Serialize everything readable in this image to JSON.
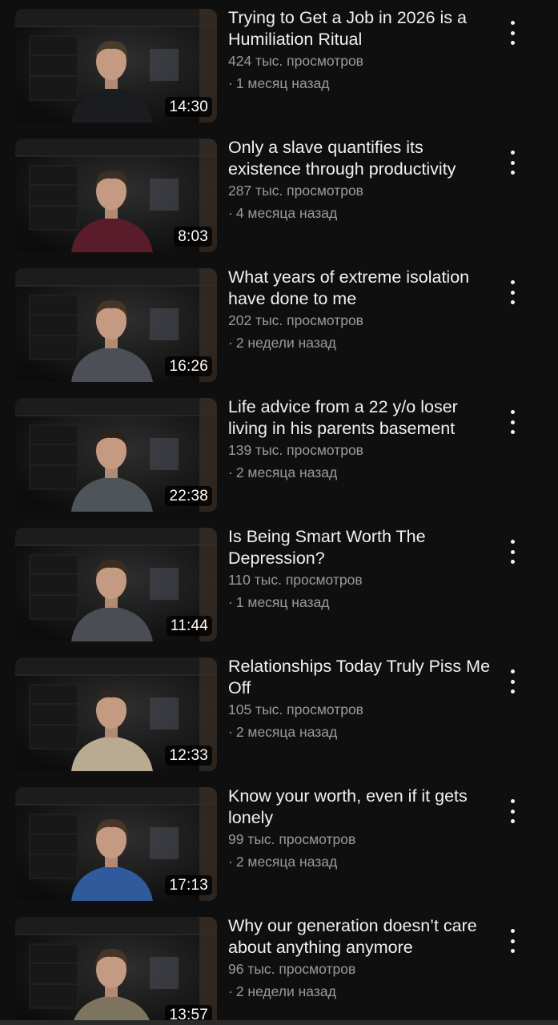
{
  "videos": [
    {
      "title": "Trying to Get a Job in 2026 is a Humiliation Ritual",
      "views": "424 тыс. просмотров",
      "age": "1 месяц назад",
      "duration": "14:30",
      "sweater": "#1b1c20",
      "hair": "#4a3a2c"
    },
    {
      "title": "Only a slave quantifies its existence through productivity",
      "views": "287 тыс. просмотров",
      "age": "4 месяца назад",
      "duration": "8:03",
      "sweater": "#5a1c2a",
      "hair": "#3e2f24"
    },
    {
      "title": "What years of extreme isolation have done to me",
      "views": "202 тыс. просмотров",
      "age": "2 недели назад",
      "duration": "16:26",
      "sweater": "#4c4f55",
      "hair": "#463526"
    },
    {
      "title": "Life advice from a 22 y/o loser living in his parents basement",
      "views": "139 тыс. просмотров",
      "age": "2 месяца назад",
      "duration": "22:38",
      "sweater": "#4f535a",
      "hair": "#2c231c"
    },
    {
      "title": "Is Being Smart Worth The Depression?",
      "views": "110 тыс. просмотров",
      "age": "1 месяц назад",
      "duration": "11:44",
      "sweater": "#4a4e54",
      "hair": "#3b2c20"
    },
    {
      "title": "Relationships Today Truly Piss Me Off",
      "views": "105 тыс. просмотров",
      "age": "2 месяца назад",
      "duration": "12:33",
      "sweater": "#b8ab92",
      "hair": "#2f261f"
    },
    {
      "title": "Know your worth, even if it gets lonely",
      "views": "99 тыс. просмотров",
      "age": "2 месяца назад",
      "duration": "17:13",
      "sweater": "#2f5a9c",
      "hair": "#4a3626"
    },
    {
      "title": "Why our generation doesn’t care about anything anymore",
      "views": "96 тыс. просмотров",
      "age": "2 недели назад",
      "duration": "13:57",
      "sweater": "#7d745f",
      "hair": "#463425"
    }
  ],
  "icons": {
    "more": "more-vert-icon",
    "separator": "·"
  }
}
